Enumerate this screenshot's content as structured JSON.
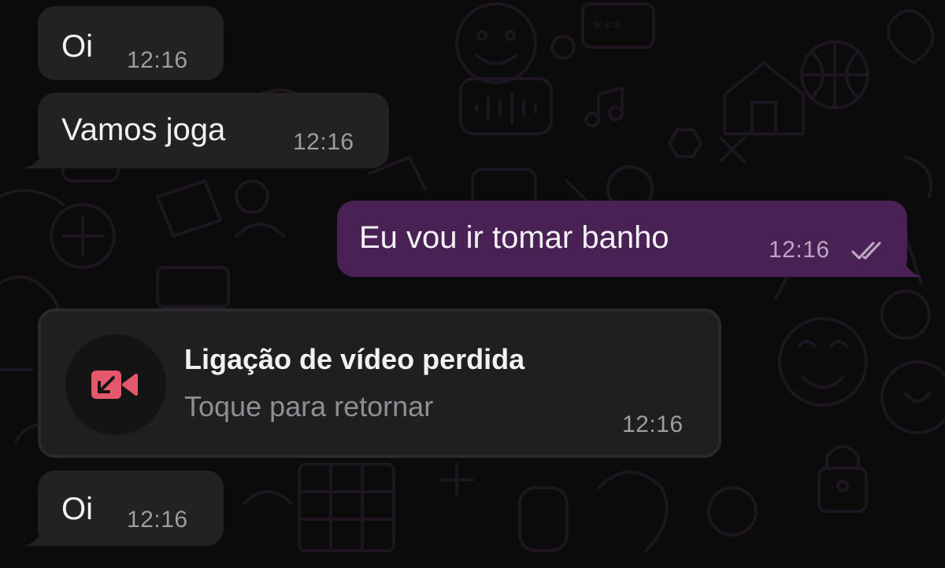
{
  "messages": [
    {
      "direction": "incoming",
      "text": "Oi",
      "time": "12:16"
    },
    {
      "direction": "incoming",
      "text": "Vamos joga",
      "time": "12:16"
    },
    {
      "direction": "outgoing",
      "text": "Eu vou ir tomar banho",
      "time": "12:16",
      "status": "read-double-check"
    },
    {
      "direction": "incoming",
      "type": "missed-call",
      "title": "Ligação de vídeo perdida",
      "subtitle": "Toque para retornar",
      "time": "12:16",
      "icon": "missed-video-call-icon"
    },
    {
      "direction": "incoming",
      "text": "Oi",
      "time": "12:16"
    }
  ],
  "colors": {
    "background": "#0b0b0c",
    "incoming_bubble": "#222223",
    "outgoing_bubble": "#4a2154",
    "missed_call_icon": "#e5576a",
    "wallpaper_doodle": "#1c151e"
  }
}
